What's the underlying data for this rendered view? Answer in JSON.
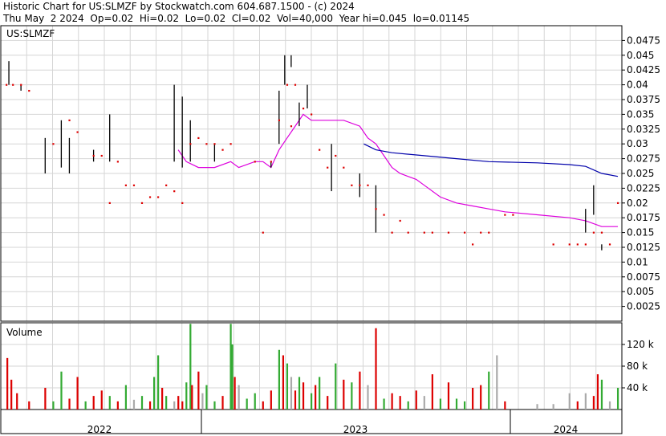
{
  "header": {
    "line1": "Historic Chart for US:SLMZF by Stockwatch.com 604.687.1500 - (c) 2024",
    "line2": "Thu May  2 2024  Op=0.02  Hi=0.02  Lo=0.02  Cl=0.02  Vol=40,000  Year hi=0.045  lo=0.01145"
  },
  "chart_data": {
    "type": "line",
    "symbol_label": "US:SLMZF",
    "price_axis": {
      "ylim": [
        0,
        0.05
      ],
      "ticks": [
        "0.0475",
        "0.045",
        "0.0425",
        "0.04",
        "0.0375",
        "0.035",
        "0.0325",
        "0.03",
        "0.0275",
        "0.025",
        "0.0225",
        "0.02",
        "0.0175",
        "0.015",
        "0.0125",
        "0.01",
        "0.0075",
        "0.005",
        "0.0025"
      ]
    },
    "volume_axis": {
      "title": "Volume",
      "ticks": [
        "120 k",
        "80 k",
        "40 k"
      ],
      "ylim": [
        0,
        160
      ]
    },
    "x_labels": [
      "2022",
      "2023",
      "2024"
    ],
    "colors": {
      "price_bar": "#000000",
      "close_dot": "#dd0000",
      "ma_short": "#dd00dd",
      "ma_long": "#0000aa",
      "vol_up": "#33aa33",
      "vol_down": "#dd0000",
      "vol_flat": "#aaaaaa",
      "grid": "#d6d6d6"
    },
    "price_bars": [
      [
        0.5,
        0.044,
        0.04
      ],
      [
        2,
        0.04,
        0.039
      ],
      [
        5,
        0.031,
        0.025
      ],
      [
        7,
        0.034,
        0.026
      ],
      [
        8,
        0.031,
        0.025
      ],
      [
        11,
        0.029,
        0.027
      ],
      [
        13,
        0.035,
        0.027
      ],
      [
        21,
        0.04,
        0.027
      ],
      [
        22,
        0.038,
        0.026
      ],
      [
        23,
        0.034,
        0.027
      ],
      [
        26,
        0.03,
        0.027
      ],
      [
        33,
        0.027,
        0.026
      ],
      [
        34,
        0.039,
        0.03
      ],
      [
        34.7,
        0.045,
        0.04
      ],
      [
        35.5,
        0.045,
        0.043
      ],
      [
        36.5,
        0.037,
        0.033
      ],
      [
        37.5,
        0.04,
        0.036
      ],
      [
        40.5,
        0.03,
        0.022
      ],
      [
        44,
        0.025,
        0.021
      ],
      [
        46,
        0.023,
        0.015
      ],
      [
        72,
        0.019,
        0.015
      ],
      [
        73,
        0.023,
        0.018
      ],
      [
        74,
        0.013,
        0.012
      ]
    ],
    "close_dots": [
      [
        0.2,
        0.04
      ],
      [
        1,
        0.04
      ],
      [
        2,
        0.04
      ],
      [
        3,
        0.039
      ],
      [
        6,
        0.03
      ],
      [
        8,
        0.034
      ],
      [
        9,
        0.032
      ],
      [
        11,
        0.028
      ],
      [
        12,
        0.028
      ],
      [
        13,
        0.02
      ],
      [
        14,
        0.027
      ],
      [
        15,
        0.023
      ],
      [
        16,
        0.023
      ],
      [
        17,
        0.02
      ],
      [
        18,
        0.021
      ],
      [
        19,
        0.021
      ],
      [
        20,
        0.023
      ],
      [
        21,
        0.022
      ],
      [
        22,
        0.02
      ],
      [
        23,
        0.03
      ],
      [
        24,
        0.031
      ],
      [
        25,
        0.03
      ],
      [
        26,
        0.03
      ],
      [
        27,
        0.029
      ],
      [
        28,
        0.03
      ],
      [
        31,
        0.027
      ],
      [
        32,
        0.015
      ],
      [
        33,
        0.027
      ],
      [
        34,
        0.034
      ],
      [
        35,
        0.04
      ],
      [
        35.5,
        0.033
      ],
      [
        36,
        0.04
      ],
      [
        37,
        0.036
      ],
      [
        38,
        0.035
      ],
      [
        39,
        0.029
      ],
      [
        40,
        0.026
      ],
      [
        41,
        0.028
      ],
      [
        42,
        0.026
      ],
      [
        43,
        0.023
      ],
      [
        44,
        0.023
      ],
      [
        45,
        0.023
      ],
      [
        46,
        0.019
      ],
      [
        47,
        0.018
      ],
      [
        48,
        0.015
      ],
      [
        49,
        0.017
      ],
      [
        50,
        0.015
      ],
      [
        52,
        0.015
      ],
      [
        53,
        0.015
      ],
      [
        55,
        0.015
      ],
      [
        57,
        0.015
      ],
      [
        58,
        0.013
      ],
      [
        59,
        0.015
      ],
      [
        60,
        0.015
      ],
      [
        62,
        0.018
      ],
      [
        63,
        0.018
      ],
      [
        68,
        0.013
      ],
      [
        70,
        0.013
      ],
      [
        71,
        0.013
      ],
      [
        72,
        0.013
      ],
      [
        73,
        0.015
      ],
      [
        74,
        0.015
      ],
      [
        75,
        0.013
      ],
      [
        76,
        0.02
      ]
    ],
    "ma_short": [
      [
        21.5,
        0.029
      ],
      [
        22.5,
        0.027
      ],
      [
        24,
        0.026
      ],
      [
        26,
        0.026
      ],
      [
        28,
        0.027
      ],
      [
        29,
        0.026
      ],
      [
        31,
        0.027
      ],
      [
        32,
        0.027
      ],
      [
        33,
        0.026
      ],
      [
        34,
        0.029
      ],
      [
        35,
        0.031
      ],
      [
        36,
        0.033
      ],
      [
        37,
        0.035
      ],
      [
        38,
        0.034
      ],
      [
        40,
        0.034
      ],
      [
        42,
        0.034
      ],
      [
        44,
        0.033
      ],
      [
        45,
        0.031
      ],
      [
        46,
        0.03
      ],
      [
        47,
        0.028
      ],
      [
        48,
        0.026
      ],
      [
        49,
        0.025
      ],
      [
        51,
        0.024
      ],
      [
        52,
        0.023
      ],
      [
        54,
        0.021
      ],
      [
        56,
        0.02
      ],
      [
        58,
        0.0195
      ],
      [
        60,
        0.019
      ],
      [
        62,
        0.0185
      ],
      [
        66,
        0.018
      ],
      [
        70,
        0.0175
      ],
      [
        72,
        0.017
      ],
      [
        74,
        0.016
      ],
      [
        76,
        0.016
      ]
    ],
    "ma_long": [
      [
        44.5,
        0.03
      ],
      [
        46,
        0.029
      ],
      [
        48,
        0.0285
      ],
      [
        52,
        0.028
      ],
      [
        56,
        0.0275
      ],
      [
        60,
        0.027
      ],
      [
        66,
        0.0268
      ],
      [
        70,
        0.0265
      ],
      [
        72,
        0.0262
      ],
      [
        74,
        0.025
      ],
      [
        76,
        0.0245
      ]
    ],
    "volume": [
      [
        0.3,
        95,
        "d"
      ],
      [
        0.8,
        55,
        "d"
      ],
      [
        1.5,
        30,
        "d"
      ],
      [
        3,
        15,
        "d"
      ],
      [
        5,
        40,
        "d"
      ],
      [
        6,
        15,
        "g"
      ],
      [
        7,
        70,
        "g"
      ],
      [
        8,
        20,
        "d"
      ],
      [
        9,
        60,
        "d"
      ],
      [
        10,
        15,
        "g"
      ],
      [
        11,
        25,
        "d"
      ],
      [
        12,
        35,
        "d"
      ],
      [
        13,
        25,
        "g"
      ],
      [
        14,
        15,
        "d"
      ],
      [
        15,
        45,
        "g"
      ],
      [
        16,
        18,
        "x"
      ],
      [
        17,
        25,
        "g"
      ],
      [
        18,
        15,
        "d"
      ],
      [
        18.5,
        60,
        "g"
      ],
      [
        19,
        100,
        "g"
      ],
      [
        19.5,
        40,
        "d"
      ],
      [
        20,
        25,
        "g"
      ],
      [
        21,
        15,
        "x"
      ],
      [
        21.5,
        25,
        "d"
      ],
      [
        22,
        15,
        "d"
      ],
      [
        22.5,
        50,
        "g"
      ],
      [
        23,
        158,
        "g"
      ],
      [
        23.2,
        45,
        "d"
      ],
      [
        24,
        70,
        "d"
      ],
      [
        24.5,
        30,
        "x"
      ],
      [
        25,
        45,
        "g"
      ],
      [
        26,
        15,
        "g"
      ],
      [
        27,
        25,
        "d"
      ],
      [
        28,
        158,
        "g"
      ],
      [
        28.2,
        120,
        "g"
      ],
      [
        28.5,
        60,
        "d"
      ],
      [
        29,
        45,
        "x"
      ],
      [
        30,
        20,
        "g"
      ],
      [
        31,
        30,
        "g"
      ],
      [
        32,
        15,
        "d"
      ],
      [
        33,
        35,
        "d"
      ],
      [
        34,
        110,
        "g"
      ],
      [
        34.5,
        100,
        "d"
      ],
      [
        35,
        85,
        "g"
      ],
      [
        35.5,
        60,
        "x"
      ],
      [
        36,
        35,
        "d"
      ],
      [
        36.5,
        60,
        "g"
      ],
      [
        37,
        50,
        "d"
      ],
      [
        38,
        30,
        "g"
      ],
      [
        38.5,
        45,
        "d"
      ],
      [
        39,
        60,
        "g"
      ],
      [
        40,
        25,
        "d"
      ],
      [
        41,
        85,
        "g"
      ],
      [
        42,
        55,
        "d"
      ],
      [
        43,
        50,
        "g"
      ],
      [
        44,
        70,
        "d"
      ],
      [
        45,
        45,
        "x"
      ],
      [
        46,
        150,
        "d"
      ],
      [
        47,
        20,
        "g"
      ],
      [
        48,
        30,
        "d"
      ],
      [
        49,
        25,
        "d"
      ],
      [
        50,
        15,
        "g"
      ],
      [
        51,
        35,
        "d"
      ],
      [
        52,
        25,
        "x"
      ],
      [
        53,
        65,
        "d"
      ],
      [
        54,
        20,
        "g"
      ],
      [
        55,
        50,
        "d"
      ],
      [
        56,
        20,
        "g"
      ],
      [
        57,
        15,
        "g"
      ],
      [
        58,
        40,
        "d"
      ],
      [
        59,
        45,
        "d"
      ],
      [
        60,
        70,
        "g"
      ],
      [
        61,
        100,
        "x"
      ],
      [
        62,
        15,
        "d"
      ],
      [
        66,
        10,
        "x"
      ],
      [
        68,
        10,
        "x"
      ],
      [
        70,
        30,
        "x"
      ],
      [
        71,
        15,
        "d"
      ],
      [
        72,
        30,
        "x"
      ],
      [
        73,
        25,
        "d"
      ],
      [
        73.5,
        65,
        "d"
      ],
      [
        74,
        55,
        "g"
      ],
      [
        75,
        15,
        "x"
      ],
      [
        76,
        40,
        "g"
      ]
    ]
  }
}
